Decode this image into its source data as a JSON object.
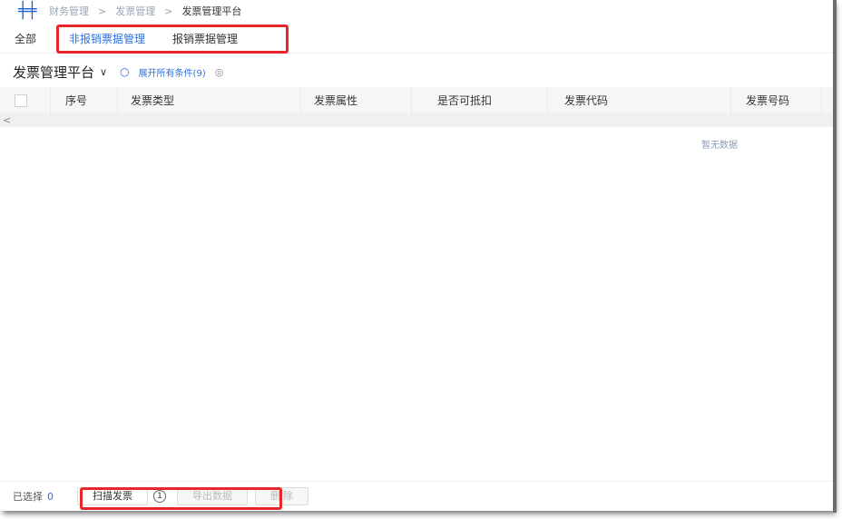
{
  "breadcrumb": {
    "items": [
      "财务管理",
      "发票管理",
      "发票管理平台"
    ],
    "separator": ">"
  },
  "tabs": [
    {
      "label": "全部"
    },
    {
      "label": "非报销票据管理",
      "active": true
    },
    {
      "label": "报销票据管理"
    }
  ],
  "header": {
    "title": "发票管理平台",
    "expand_label": "展开所有条件(9)"
  },
  "table": {
    "columns": [
      "序号",
      "发票类型",
      "发票属性",
      "是否可抵扣",
      "发票代码",
      "发票号码"
    ],
    "scroll_left": "<",
    "empty_text": "暂无数据"
  },
  "footer": {
    "selected_label": "已选择",
    "selected_count": "0",
    "scan_label": "扫描发票",
    "info": "1",
    "export_label": "导出数据",
    "delete_label": "删 除"
  },
  "colors": {
    "accent": "#2f6fe0",
    "highlight": "#e8262b"
  }
}
